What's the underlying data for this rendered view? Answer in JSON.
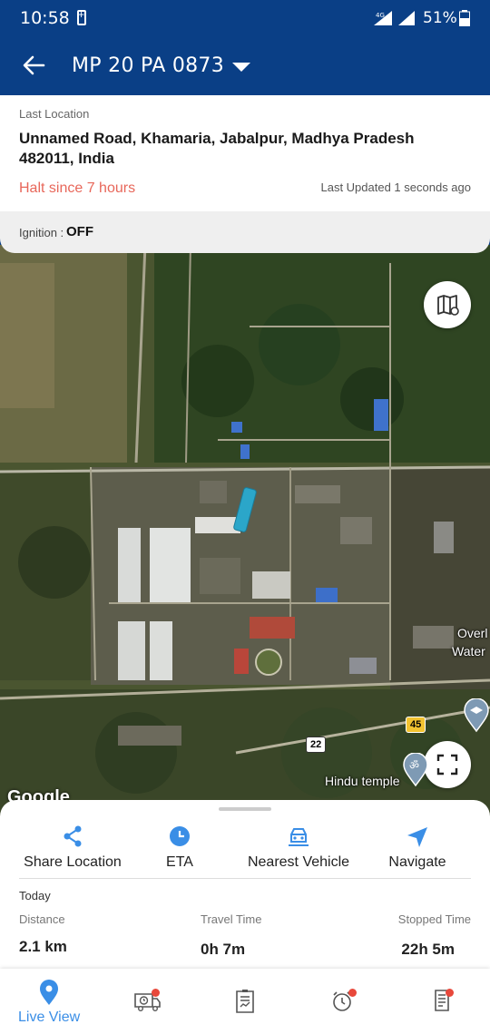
{
  "status_bar": {
    "time": "10:58",
    "network": "4G",
    "battery_percent": "51%"
  },
  "app_bar": {
    "title": "MP 20 PA 0873",
    "back_icon": "arrow-left-icon",
    "dropdown_icon": "caret-down-icon"
  },
  "location": {
    "label": "Last Location",
    "address": "Unnamed Road, Khamaria, Jabalpur, Madhya Pradesh 482011, India",
    "halt_text": "Halt since 7 hours",
    "last_updated": "Last Updated 1 seconds ago",
    "ignition_label": "Ignition :",
    "ignition_value": "OFF"
  },
  "map": {
    "place_labels": [
      "Overl",
      "Water",
      "Hindu temple"
    ],
    "road_shields": [
      "45",
      "22"
    ],
    "attribution": "Google",
    "layers_button_icon": "map-layers-icon",
    "fullscreen_button_icon": "fullscreen-icon"
  },
  "actions": [
    {
      "label": "Share Location",
      "icon": "share-icon"
    },
    {
      "label": "ETA",
      "icon": "clock-icon"
    },
    {
      "label": "Nearest Vehicle",
      "icon": "vehicle-icon"
    },
    {
      "label": "Navigate",
      "icon": "navigate-icon"
    }
  ],
  "stats": {
    "period": "Today",
    "items": [
      {
        "label": "Distance",
        "value": "2.1 km"
      },
      {
        "label": "Travel Time",
        "value": "0h 7m"
      },
      {
        "label": "Stopped Time",
        "value": "22h 5m"
      }
    ]
  },
  "bottom_nav": {
    "items": [
      {
        "label": "Live View",
        "icon": "location-pin-icon",
        "active": true
      },
      {
        "icon": "truck-clock-icon",
        "badge": true
      },
      {
        "icon": "report-icon",
        "badge": false
      },
      {
        "icon": "alarm-icon",
        "badge": true
      },
      {
        "icon": "document-list-icon",
        "badge": true
      }
    ]
  },
  "colors": {
    "primary": "#0a3f86",
    "accent": "#3a8ee6",
    "halt": "#e8675a",
    "badge": "#e8483b"
  }
}
